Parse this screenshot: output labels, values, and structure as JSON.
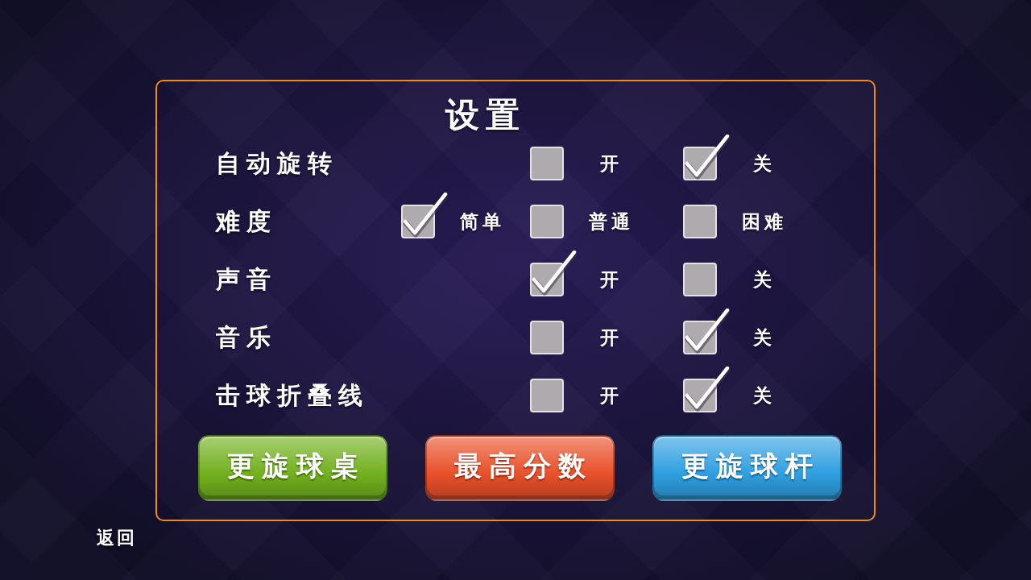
{
  "title": "设置",
  "settings": [
    {
      "label": "自动旋转",
      "options": [
        {
          "label": "开",
          "selected": false
        },
        {
          "label": "关",
          "selected": true
        }
      ]
    },
    {
      "label": "难度",
      "options": [
        {
          "label": "简单",
          "selected": true
        },
        {
          "label": "普通",
          "selected": false
        },
        {
          "label": "困难",
          "selected": false
        }
      ]
    },
    {
      "label": "声音",
      "options": [
        {
          "label": "开",
          "selected": true
        },
        {
          "label": "关",
          "selected": false
        }
      ]
    },
    {
      "label": "音乐",
      "options": [
        {
          "label": "开",
          "selected": false
        },
        {
          "label": "关",
          "selected": true
        }
      ]
    },
    {
      "label": "击球折叠线",
      "options": [
        {
          "label": "开",
          "selected": false
        },
        {
          "label": "关",
          "selected": true
        }
      ]
    }
  ],
  "buttons": [
    {
      "label": "更旋球桌",
      "color": "#72b01e"
    },
    {
      "label": "最高分数",
      "color": "#e8502a"
    },
    {
      "label": "更旋球杆",
      "color": "#2f9fe0"
    }
  ],
  "back": "返回"
}
